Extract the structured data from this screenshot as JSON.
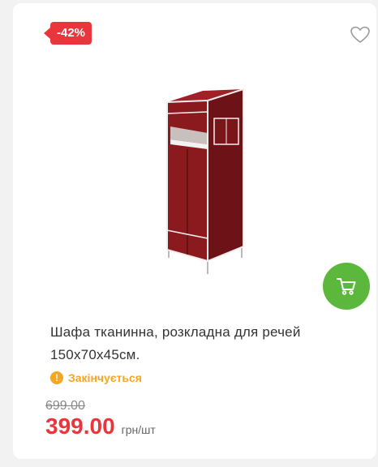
{
  "product": {
    "discount_badge": "-42%",
    "title": "Шафа тканинна, розкладна для речей 150х70х45см.",
    "status": "Закінчується",
    "old_price": "699.00",
    "price": "399.00",
    "unit": "грн/шт"
  },
  "colors": {
    "badge": "#e8363c",
    "price": "#e8363c",
    "status": "#f5a623",
    "cart_button": "#5cb83c",
    "product_fabric": "#8b1a1e"
  },
  "icons": {
    "wishlist": "heart-outline-icon",
    "cart": "shopping-cart-icon",
    "status": "exclamation-circle-icon"
  }
}
